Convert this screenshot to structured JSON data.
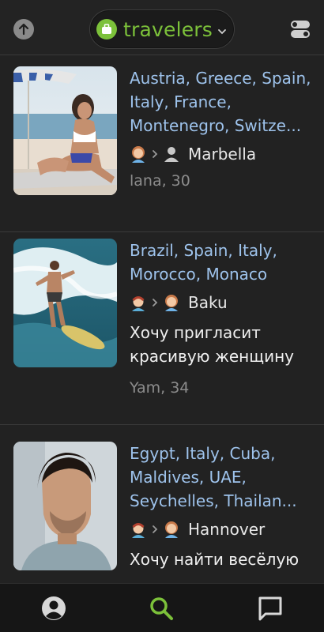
{
  "header": {
    "brand_text": "travelers",
    "brand_color": "#7cc13a",
    "icons": [
      "arrow-up-icon",
      "suitcase-icon",
      "chevron-down-icon",
      "toggle-settings-icon"
    ]
  },
  "cards": [
    {
      "countries": "Austria, Greece, Spain, Italy, France, Montenegro, Switze...",
      "route_from_icon": "woman-avatar-icon",
      "route_to_icon": "person-silhouette-icon",
      "city": "Marbella",
      "message": "",
      "meta": "lana, 30"
    },
    {
      "countries": "Brazil, Spain, Italy, Morocco, Monaco",
      "route_from_icon": "man-avatar-icon",
      "route_to_icon": "woman-avatar-icon",
      "city": "Baku",
      "message": "Хочу пригласит красивую женщину",
      "meta": "Yam, 34"
    },
    {
      "countries": "Egypt, Italy, Cuba, Maldives, UAE, Seychelles, Thailan...",
      "route_from_icon": "man-avatar-icon",
      "route_to_icon": "woman-avatar-icon",
      "city": "Hannover",
      "message": "Хочу найти весёлую",
      "meta": ""
    }
  ],
  "tabbar": {
    "tabs": [
      "profile-icon",
      "search-icon",
      "chat-icon"
    ],
    "active_tab": "search-icon",
    "active_color": "#7cc13a"
  },
  "colors": {
    "background": "#222222",
    "link": "#9ec3ec",
    "muted": "#8c8c8c"
  }
}
